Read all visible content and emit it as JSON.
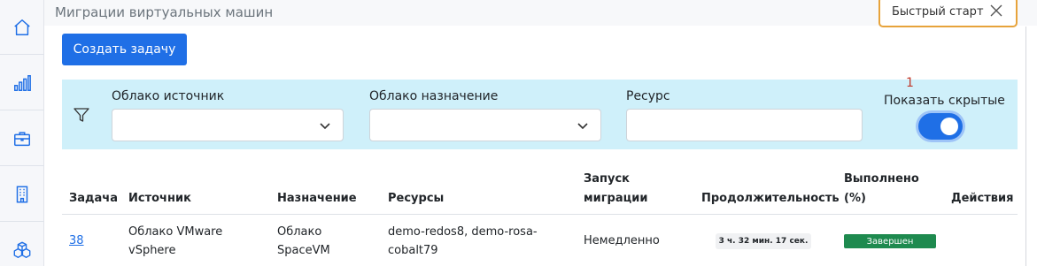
{
  "page": {
    "title": "Миграции виртуальных машин"
  },
  "sidebar": {
    "items": [
      {
        "icon": "home-icon"
      },
      {
        "icon": "chart-icon"
      },
      {
        "icon": "briefcase-icon"
      },
      {
        "icon": "building-icon"
      },
      {
        "icon": "cubes-icon"
      }
    ]
  },
  "quick_start": {
    "label": "Быстрый старт"
  },
  "toolbar": {
    "create_label": "Создать задачу"
  },
  "filters": {
    "source_cloud_label": "Облако источник",
    "target_cloud_label": "Облако назначение",
    "resource_label": "Ресурс",
    "show_hidden_label": "Показать скрытые",
    "show_hidden_on": true,
    "badge": "1"
  },
  "table": {
    "headers": {
      "task": "Задача",
      "source": "Источник",
      "target": "Назначение",
      "resources": "Ресурсы",
      "launch": "Запуск миграции",
      "duration": "Продолжительность",
      "done": "Выполнено (%)",
      "actions": "Действия"
    },
    "rows": [
      {
        "task": "38",
        "source": "Облако VMware vSphere",
        "target": "Облако SpaceVM",
        "resources": "demo-redos8, demo-rosa-cobalt79",
        "launch": "Немедленно",
        "duration": "3 ч. 32 мин. 17 сек.",
        "status": "Завершен",
        "status_color": "#1e8a4f"
      }
    ]
  },
  "colors": {
    "accent": "#1f6fe6",
    "filter_bg": "#cff0fa",
    "quickstart_border": "#e7a33b"
  }
}
